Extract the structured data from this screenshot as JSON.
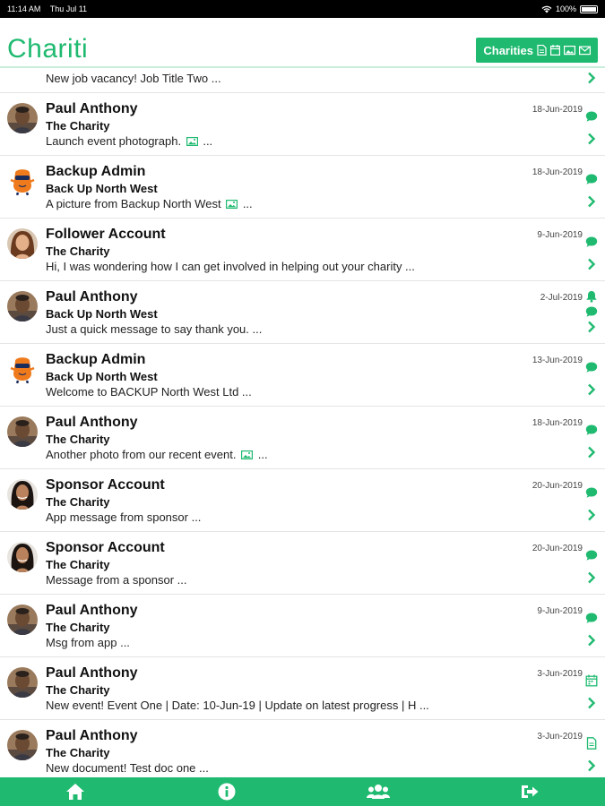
{
  "status_bar": {
    "time": "11:14 AM",
    "date": "Thu Jul 11",
    "battery": "100%"
  },
  "header": {
    "logo": "Chariti",
    "charities_button": "Charities"
  },
  "first_item": {
    "message": "New job vacancy! Job Title Two ..."
  },
  "messages": [
    {
      "avatar": "man",
      "name": "Paul Anthony",
      "charity": "The Charity",
      "message": "Launch event photograph.",
      "attachment": "image",
      "date": "18-Jun-2019",
      "indicator": "chat"
    },
    {
      "avatar": "mascot",
      "name": "Backup Admin",
      "charity": "Back Up North West",
      "message": "A picture from Backup North West",
      "attachment": "image",
      "date": "18-Jun-2019",
      "indicator": "chat"
    },
    {
      "avatar": "woman",
      "name": "Follower Account",
      "charity": "The Charity",
      "message": "Hi, I was wondering how I can get involved in helping out your charity ...",
      "attachment": "",
      "date": "9-Jun-2019",
      "indicator": "chat"
    },
    {
      "avatar": "man",
      "name": "Paul Anthony",
      "charity": "Back Up North West",
      "message": "Just a quick message to say thank you. ...",
      "attachment": "",
      "date": "2-Jul-2019",
      "indicator": "chat",
      "bell": true
    },
    {
      "avatar": "mascot",
      "name": "Backup Admin",
      "charity": "Back Up North West",
      "message": "Welcome to BACKUP North West Ltd ...",
      "attachment": "",
      "date": "13-Jun-2019",
      "indicator": "chat"
    },
    {
      "avatar": "man",
      "name": "Paul Anthony",
      "charity": "The Charity",
      "message": "Another photo from our recent event.",
      "attachment": "image",
      "date": "18-Jun-2019",
      "indicator": "chat"
    },
    {
      "avatar": "woman2",
      "name": "Sponsor Account",
      "charity": "The Charity",
      "message": "App message from sponsor ...",
      "attachment": "",
      "date": "20-Jun-2019",
      "indicator": "chat"
    },
    {
      "avatar": "woman2",
      "name": "Sponsor Account",
      "charity": "The Charity",
      "message": "Message from a sponsor ...",
      "attachment": "",
      "date": "20-Jun-2019",
      "indicator": "chat"
    },
    {
      "avatar": "man",
      "name": "Paul Anthony",
      "charity": "The Charity",
      "message": "Msg from app ...",
      "attachment": "",
      "date": "9-Jun-2019",
      "indicator": "chat"
    },
    {
      "avatar": "man",
      "name": "Paul Anthony",
      "charity": "The Charity",
      "message": "New event! Event One | Date: 10-Jun-19 | Update on latest progress | H ...",
      "attachment": "",
      "date": "3-Jun-2019",
      "indicator": "calendar"
    },
    {
      "avatar": "man",
      "name": "Paul Anthony",
      "charity": "The Charity",
      "message": "New document! Test doc one ...",
      "attachment": "",
      "date": "3-Jun-2019",
      "indicator": "document"
    }
  ],
  "tabs": [
    {
      "icon": "home-icon"
    },
    {
      "icon": "info-icon"
    },
    {
      "icon": "users-icon"
    },
    {
      "icon": "logout-icon"
    }
  ],
  "colors": {
    "brand": "#1fba70",
    "divider": "#e4e4e4"
  }
}
